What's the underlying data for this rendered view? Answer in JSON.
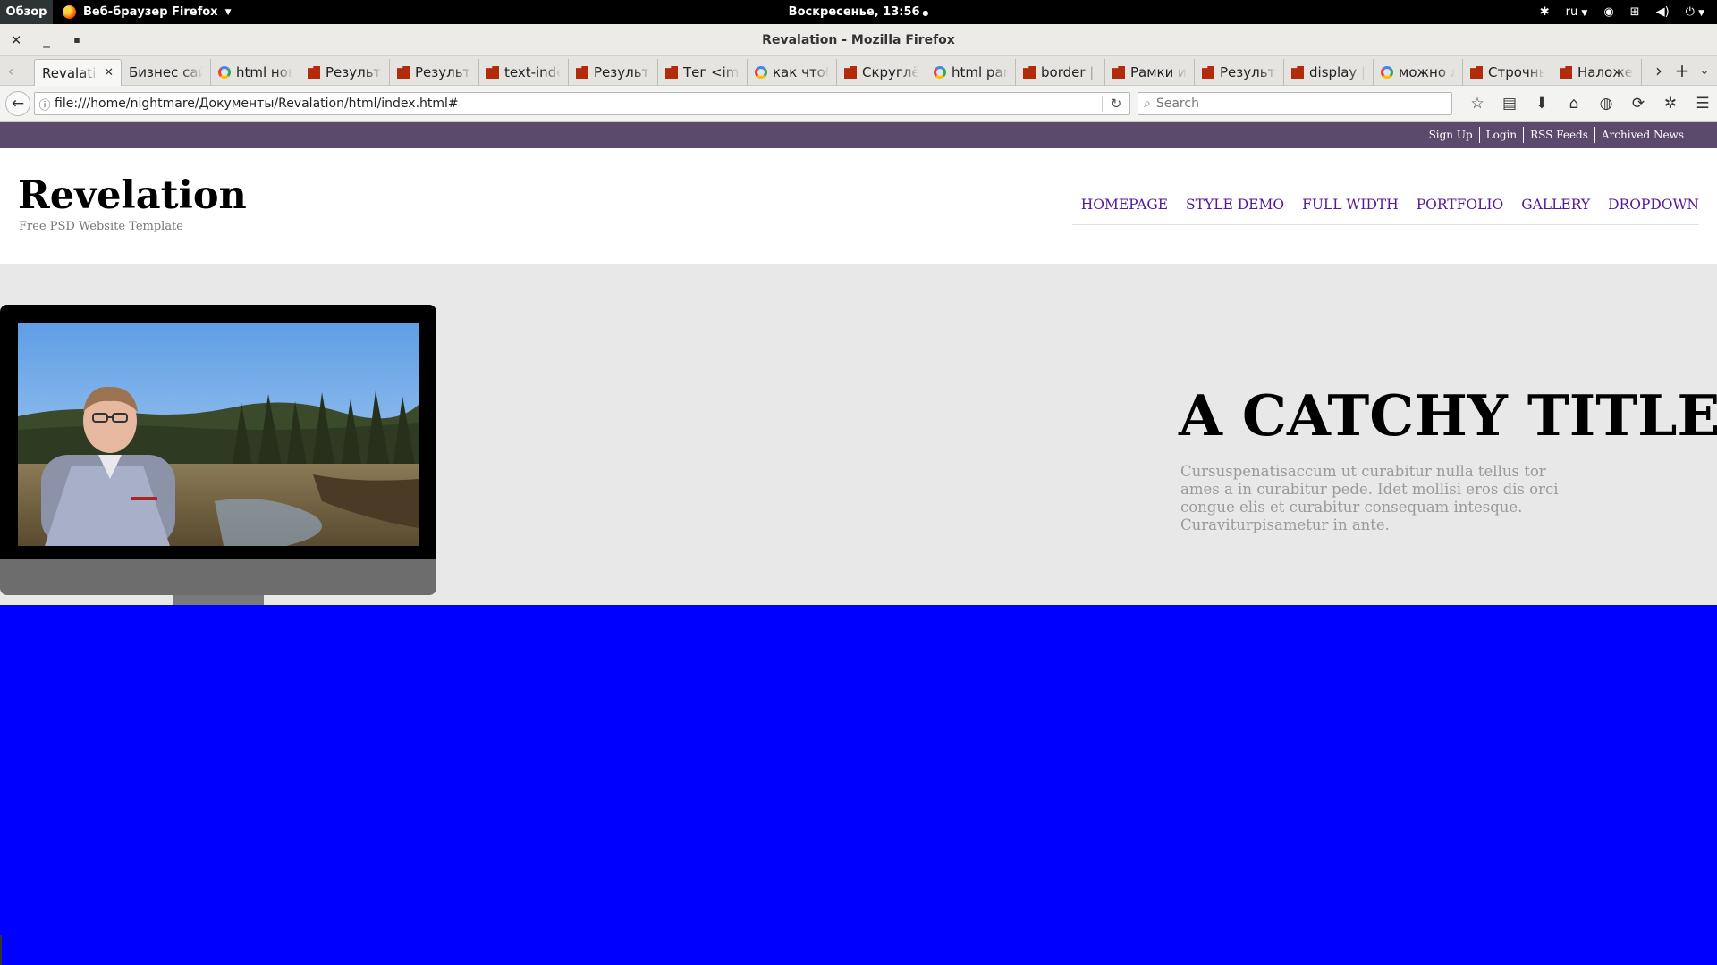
{
  "gnome": {
    "overview": "Обзор",
    "app_menu": "Веб-браузер Firefox",
    "clock": "Воскресенье, 13:56",
    "lang": "ru"
  },
  "window": {
    "title": "Revalation - Mozilla Firefox"
  },
  "tabs": [
    {
      "label": "Revalation",
      "favicon": "none",
      "active": true
    },
    {
      "label": "Бизнес сайт",
      "favicon": "none"
    },
    {
      "label": "html новая",
      "favicon": "google"
    },
    {
      "label": "Результат",
      "favicon": "site"
    },
    {
      "label": "Результат",
      "favicon": "site"
    },
    {
      "label": "text-indent",
      "favicon": "site"
    },
    {
      "label": "Результат",
      "favicon": "site"
    },
    {
      "label": "Тег <img>",
      "favicon": "site"
    },
    {
      "label": "как чтобы",
      "favicon": "google"
    },
    {
      "label": "Скруглённые",
      "favicon": "site"
    },
    {
      "label": "html рамка",
      "favicon": "google"
    },
    {
      "label": "border |",
      "favicon": "site"
    },
    {
      "label": "Рамки и",
      "favicon": "site"
    },
    {
      "label": "Результат",
      "favicon": "site"
    },
    {
      "label": "display |",
      "favicon": "site"
    },
    {
      "label": "можно ли",
      "favicon": "google"
    },
    {
      "label": "Строчные",
      "favicon": "site"
    },
    {
      "label": "Наложение",
      "favicon": "site"
    }
  ],
  "navbar": {
    "url": "file:///home/nightmare/Документы/Revalation/html/index.html#",
    "search_placeholder": "Search"
  },
  "site": {
    "utility_links": [
      "Sign Up",
      "Login",
      "RSS Feeds",
      "Archived News"
    ],
    "logo": "Revelation",
    "tagline": "Free PSD Website Template",
    "nav": [
      "HOMEPAGE",
      "STYLE DEMO",
      "FULL WIDTH",
      "PORTFOLIO",
      "GALLERY",
      "DROPDOWN"
    ],
    "hero": {
      "title": "A CATCHY TITLE",
      "text": "Cursuspenatisaccum ut curabitur nulla tellus tor ames a in curabitur pede. Idet mollisi eros dis orci congue elis et curabitur consequam intesque. Curaviturpisametur in ante."
    }
  },
  "colors": {
    "utility_bar": "#5b4a6c",
    "nav_link": "#56189a",
    "hero_bg": "#e8e8e8",
    "page_bg": "#0000ff"
  }
}
